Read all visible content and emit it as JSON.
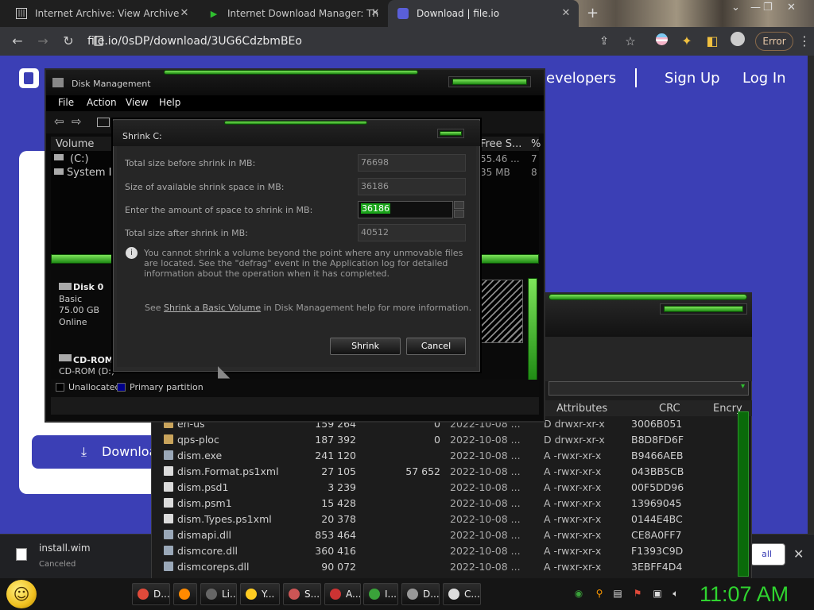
{
  "browser": {
    "tabs": [
      {
        "title": "Internet Archive: View Archive"
      },
      {
        "title": "Internet Download Manager: Th"
      },
      {
        "title": "Download | file.io"
      }
    ],
    "new_tab": "+",
    "url": "file.io/0sDP/download/3UG6CdzbmBEo",
    "error_label": "Error"
  },
  "site": {
    "nav": {
      "developers": "evelopers",
      "signup": "Sign Up",
      "login": "Log In",
      "separator": "|"
    },
    "download_button": "Downloa"
  },
  "shelf": {
    "filename": "install.wim",
    "status": "Canceled",
    "show_all": "all"
  },
  "disk_mgmt": {
    "title": "Disk Management",
    "menu": [
      "File",
      "Action",
      "View",
      "Help"
    ],
    "list_headers": {
      "volume": "Volume",
      "free": "Free S...",
      "pct": "%"
    },
    "volumes": [
      {
        "name": "(C:)",
        "free": "55.46 ...",
        "pct": "7"
      },
      {
        "name": "System I",
        "free": "35 MB",
        "pct": "8"
      }
    ],
    "disk0": {
      "name": "Disk 0",
      "type": "Basic",
      "size": "75.00 GB",
      "status": "Online"
    },
    "cdrom": {
      "name": "CD-ROM",
      "drive": "CD-ROM (D:)"
    },
    "legend": {
      "unallocated": "Unallocated",
      "primary": "Primary partition"
    },
    "colors": {
      "unallocated": "#000000",
      "primary": "#00008b"
    }
  },
  "shrink": {
    "title": "Shrink C:",
    "fields": [
      {
        "label": "Total size before shrink in MB:",
        "value": "76698"
      },
      {
        "label": "Size of available shrink space in MB:",
        "value": "36186"
      },
      {
        "label": "Enter the amount of space to shrink in MB:",
        "value": "36186"
      },
      {
        "label": "Total size after shrink in MB:",
        "value": "40512"
      }
    ],
    "info": "You cannot shrink a volume beyond the point where any unmovable files are located. See the \"defrag\" event in the Application log for detailed information about the operation when it has completed.",
    "see_prefix": "See",
    "see_link": "Shrink a Basic Volume",
    "see_suffix": "in Disk Management help for more information.",
    "shrink_button": "Shrink",
    "cancel_button": "Cancel"
  },
  "filemgr": {
    "headers": {
      "attributes": "Attributes",
      "crc": "CRC",
      "encr": "Encry"
    },
    "rows": [
      {
        "icon": "folder",
        "name": "en-us",
        "size": "159 264",
        "packed": "0",
        "date": "2022-10-08 ...",
        "attr": "D drwxr-xr-x",
        "crc": "3006B051"
      },
      {
        "icon": "folder",
        "name": "qps-ploc",
        "size": "187 392",
        "packed": "0",
        "date": "2022-10-08 ...",
        "attr": "D drwxr-xr-x",
        "crc": "B8D8FD6F"
      },
      {
        "icon": "exe",
        "name": "dism.exe",
        "size": "241 120",
        "packed": "",
        "date": "2022-10-08 ...",
        "attr": "A -rwxr-xr-x",
        "crc": "B9466AEB"
      },
      {
        "icon": "doc",
        "name": "dism.Format.ps1xml",
        "size": "27 105",
        "packed": "57 652",
        "date": "2022-10-08 ...",
        "attr": "A -rwxr-xr-x",
        "crc": "043BB5CB"
      },
      {
        "icon": "doc",
        "name": "dism.psd1",
        "size": "3 239",
        "packed": "",
        "date": "2022-10-08 ...",
        "attr": "A -rwxr-xr-x",
        "crc": "00F5DD96"
      },
      {
        "icon": "doc",
        "name": "dism.psm1",
        "size": "15 428",
        "packed": "",
        "date": "2022-10-08 ...",
        "attr": "A -rwxr-xr-x",
        "crc": "13969045"
      },
      {
        "icon": "doc",
        "name": "dism.Types.ps1xml",
        "size": "20 378",
        "packed": "",
        "date": "2022-10-08 ...",
        "attr": "A -rwxr-xr-x",
        "crc": "0144E4BC"
      },
      {
        "icon": "exe",
        "name": "dismapi.dll",
        "size": "853 464",
        "packed": "",
        "date": "2022-10-08 ...",
        "attr": "A -rwxr-xr-x",
        "crc": "CE8A0FF7"
      },
      {
        "icon": "exe",
        "name": "dismcore.dll",
        "size": "360 416",
        "packed": "",
        "date": "2022-10-08 ...",
        "attr": "A -rwxr-xr-x",
        "crc": "F1393C9D"
      },
      {
        "icon": "exe",
        "name": "dismcoreps.dll",
        "size": "90 072",
        "packed": "",
        "date": "2022-10-08 ...",
        "attr": "A -rwxr-xr-x",
        "crc": "3EBFF4D4"
      }
    ]
  },
  "taskbar": {
    "items": [
      {
        "label": "D...",
        "color": "#e04a3a"
      },
      {
        "label": "",
        "color": "#ff8a00"
      },
      {
        "label": "Li...",
        "color": "#666666"
      },
      {
        "label": "Y...",
        "color": "#ffcc22"
      },
      {
        "label": "S...",
        "color": "#cc5555"
      },
      {
        "label": "A...",
        "color": "#cc3333"
      },
      {
        "label": "I...",
        "color": "#3aa23a"
      },
      {
        "label": "D...",
        "color": "#999999"
      },
      {
        "label": "C...",
        "color": "#dddddd"
      }
    ],
    "clock": "11:07 AM"
  }
}
